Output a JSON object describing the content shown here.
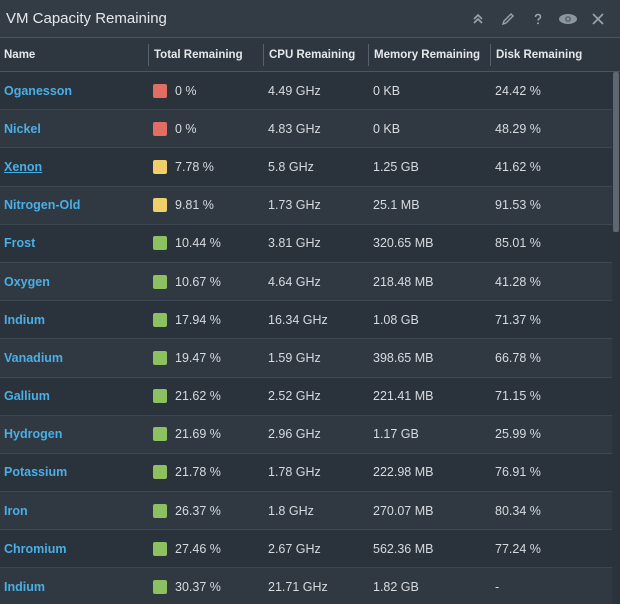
{
  "widget": {
    "title": "VM Capacity Remaining",
    "actions": [
      "collapse-icon",
      "edit-icon",
      "help-icon",
      "eye-icon",
      "close-icon"
    ]
  },
  "table": {
    "columns": [
      "Name",
      "Total Remaining",
      "CPU Remaining",
      "Memory Remaining",
      "Disk Remaining"
    ],
    "colors": {
      "red": "#e26d63",
      "yellow": "#efce6b",
      "green": "#8cc061"
    },
    "rows": [
      {
        "name": "Oganesson",
        "status": "red",
        "total": "0 %",
        "cpu": "4.49 GHz",
        "memory": "0 KB",
        "disk": "24.42 %"
      },
      {
        "name": "Nickel",
        "status": "red",
        "total": "0 %",
        "cpu": "4.83 GHz",
        "memory": "0 KB",
        "disk": "48.29 %"
      },
      {
        "name": "Xenon",
        "status": "yellow",
        "total": "7.78 %",
        "cpu": "5.8 GHz",
        "memory": "1.25 GB",
        "disk": "41.62 %",
        "underline": true
      },
      {
        "name": "Nitrogen-Old",
        "status": "yellow",
        "total": "9.81 %",
        "cpu": "1.73 GHz",
        "memory": "25.1 MB",
        "disk": "91.53 %"
      },
      {
        "name": "Frost",
        "status": "green",
        "total": "10.44 %",
        "cpu": "3.81 GHz",
        "memory": "320.65 MB",
        "disk": "85.01 %"
      },
      {
        "name": "Oxygen",
        "status": "green",
        "total": "10.67 %",
        "cpu": "4.64 GHz",
        "memory": "218.48 MB",
        "disk": "41.28 %"
      },
      {
        "name": "Indium",
        "status": "green",
        "total": "17.94 %",
        "cpu": "16.34 GHz",
        "memory": "1.08 GB",
        "disk": "71.37 %"
      },
      {
        "name": "Vanadium",
        "status": "green",
        "total": "19.47 %",
        "cpu": "1.59 GHz",
        "memory": "398.65 MB",
        "disk": "66.78 %"
      },
      {
        "name": "Gallium",
        "status": "green",
        "total": "21.62 %",
        "cpu": "2.52 GHz",
        "memory": "221.41 MB",
        "disk": "71.15 %"
      },
      {
        "name": "Hydrogen",
        "status": "green",
        "total": "21.69 %",
        "cpu": "2.96 GHz",
        "memory": "1.17 GB",
        "disk": "25.99 %"
      },
      {
        "name": "Potassium",
        "status": "green",
        "total": "21.78 %",
        "cpu": "1.78 GHz",
        "memory": "222.98 MB",
        "disk": "76.91 %"
      },
      {
        "name": "Iron",
        "status": "green",
        "total": "26.37 %",
        "cpu": "1.8 GHz",
        "memory": "270.07 MB",
        "disk": "80.34 %"
      },
      {
        "name": "Chromium",
        "status": "green",
        "total": "27.46 %",
        "cpu": "2.67 GHz",
        "memory": "562.36 MB",
        "disk": "77.24 %"
      },
      {
        "name": "Indium",
        "status": "green",
        "total": "30.37 %",
        "cpu": "21.71 GHz",
        "memory": "1.82 GB",
        "disk": "-"
      }
    ]
  }
}
